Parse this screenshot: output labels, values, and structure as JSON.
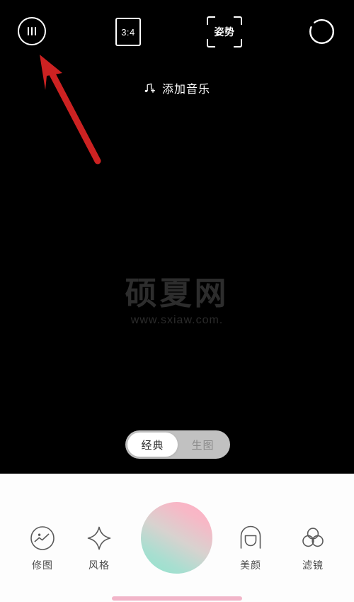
{
  "app": {
    "name": "Camera",
    "background_color": "#000000",
    "panel_color": "#fdfdfd"
  },
  "topbar": {
    "settings": {
      "name": "settings-button",
      "icon": "sliders-icon"
    },
    "ratio": {
      "name": "aspect-ratio-button",
      "value": "3:4"
    },
    "pose": {
      "name": "pose-button",
      "label": "姿势"
    },
    "flip": {
      "name": "flip-camera-button",
      "icon": "camera-flip-icon"
    }
  },
  "music": {
    "icon": "music-note-plus-icon",
    "label": "添加音乐"
  },
  "watermark": {
    "title": "硕夏网",
    "url": "www.sxiaw.com.",
    "color": "#2d2d2d"
  },
  "mode_toggle": {
    "options": [
      {
        "label": "经典",
        "active": true
      },
      {
        "label": "生图",
        "active": false
      }
    ],
    "selected": "经典"
  },
  "tools": [
    {
      "label": "修图",
      "icon": "photo-edit-circle-icon"
    },
    {
      "label": "风格",
      "icon": "sparkle-star-icon"
    },
    {
      "label": "美颜",
      "icon": "beauty-face-icon"
    },
    {
      "label": "滤镜",
      "icon": "three-circles-filter-icon"
    }
  ],
  "shutter": {
    "name": "shutter-button",
    "gradient_from": "#ffaec4",
    "gradient_to": "#8fe3cd"
  },
  "home_indicator": {
    "color": "#f0a8c0"
  },
  "annotation": {
    "type": "arrow",
    "color": "#cc2222",
    "points_to": "settings-button"
  }
}
